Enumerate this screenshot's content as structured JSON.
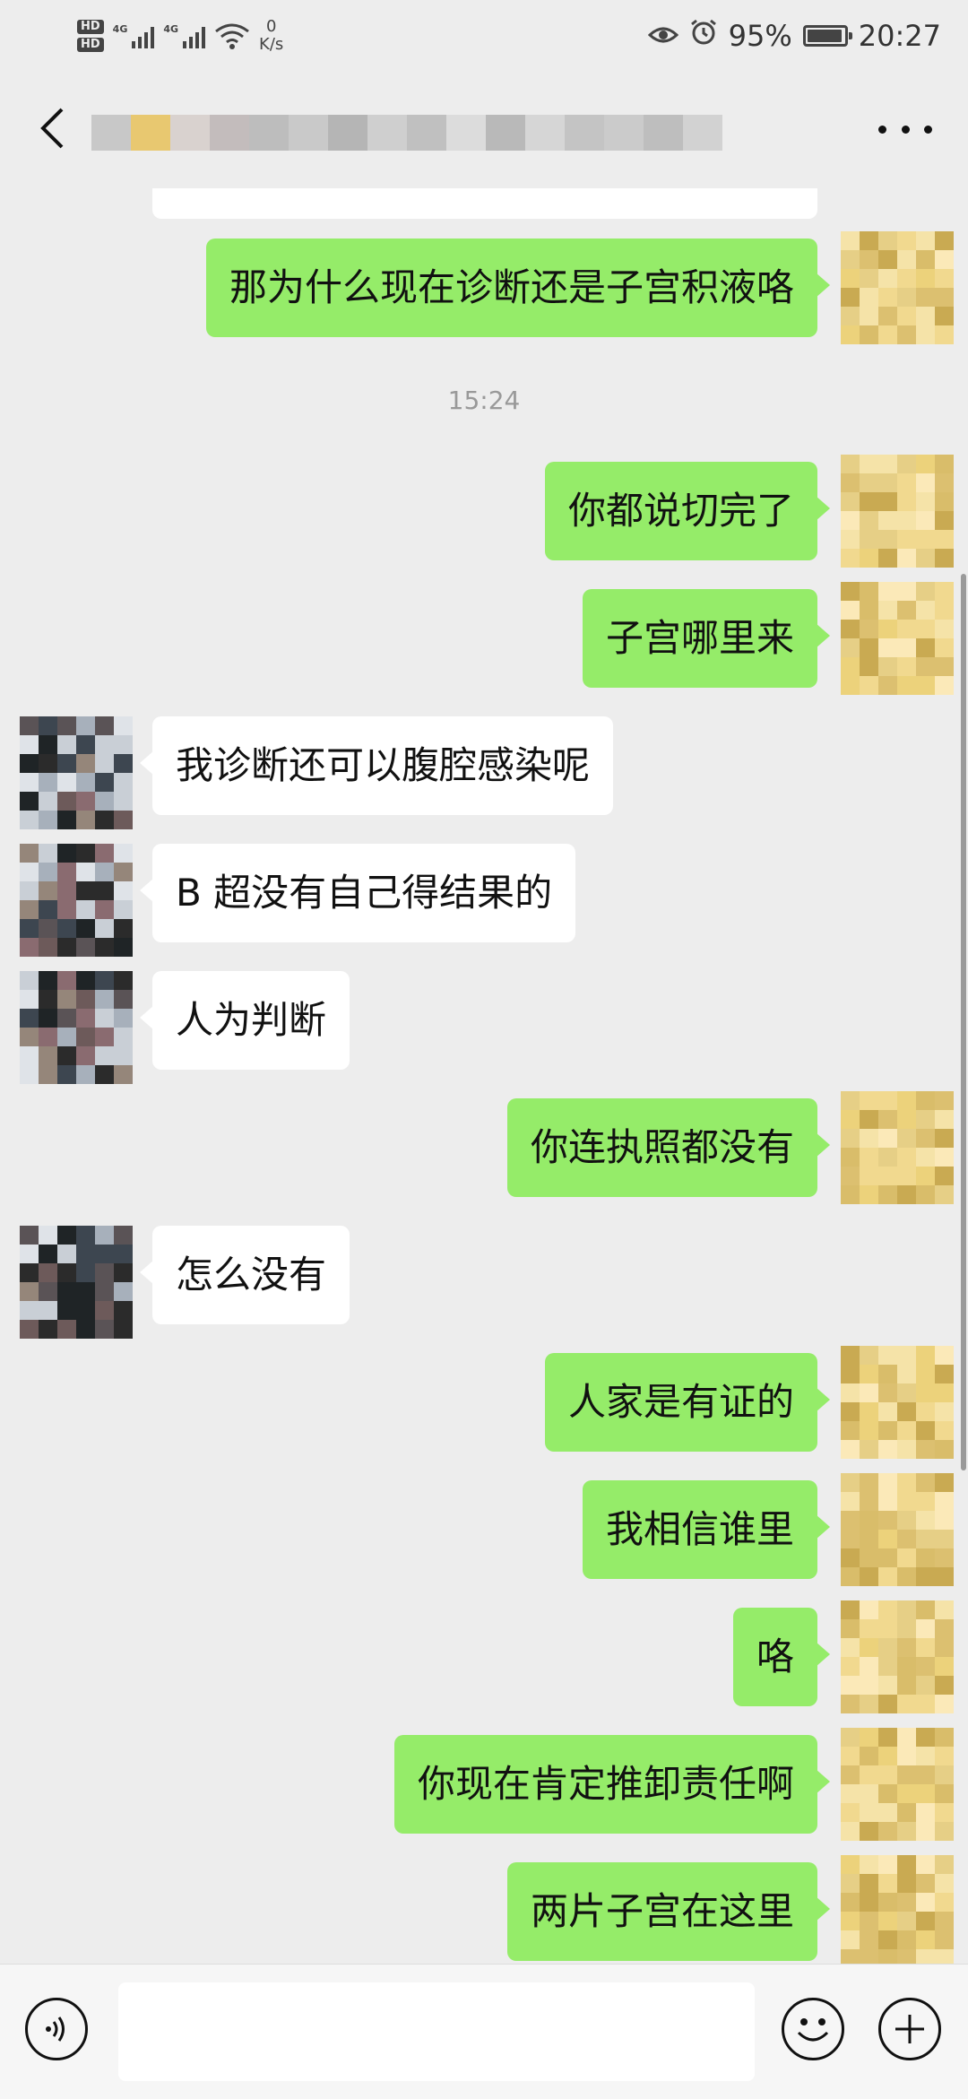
{
  "status_bar": {
    "hd1": "HD",
    "hd2": "HD",
    "net1": "4G",
    "net2": "4G",
    "speed_value": "0",
    "speed_unit": "K/s",
    "battery": "95%",
    "battery_level": 0.95,
    "time": "20:27"
  },
  "header": {
    "back_icon": "chevron-left-icon",
    "more_icon": "more-dots-icon"
  },
  "messages": [
    {
      "side": "me",
      "text": "那为什么现在诊断还是子宫积液咯"
    },
    {
      "type": "timestamp",
      "text": "15:24"
    },
    {
      "side": "me",
      "text": "你都说切完了"
    },
    {
      "side": "me",
      "text": "子宫哪里来"
    },
    {
      "side": "other",
      "text": "我诊断还可以腹腔感染呢"
    },
    {
      "side": "other",
      "text": "B 超没有自己得结果的"
    },
    {
      "side": "other",
      "text": "人为判断"
    },
    {
      "side": "me",
      "text": "你连执照都没有"
    },
    {
      "side": "other",
      "text": "怎么没有"
    },
    {
      "side": "me",
      "text": "人家是有证的"
    },
    {
      "side": "me",
      "text": "我相信谁里"
    },
    {
      "side": "me",
      "text": "咯"
    },
    {
      "side": "me",
      "text": "你现在肯定推卸责任啊"
    },
    {
      "side": "me",
      "text": "两片子宫在这里"
    }
  ],
  "input_bar": {
    "voice_icon": "voice-icon",
    "emoji_icon": "emoji-icon",
    "plus_icon": "plus-icon",
    "input_value": ""
  },
  "colors": {
    "background": "#ededed",
    "my_bubble": "#95ec69",
    "other_bubble": "#ffffff",
    "timestamp": "#999999"
  }
}
